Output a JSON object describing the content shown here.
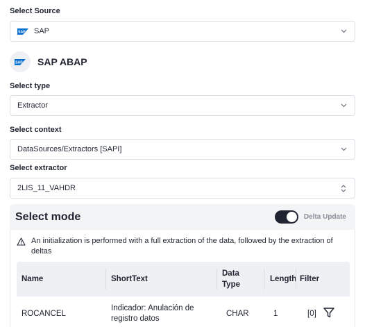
{
  "source": {
    "label": "Select Source",
    "value": "SAP",
    "title": "SAP ABAP",
    "logo_icon": "sap-logo-icon"
  },
  "type": {
    "label": "Select type",
    "value": "Extractor"
  },
  "context": {
    "label": "Select context",
    "value": "DataSources/Extractors [SAPI]"
  },
  "extractor": {
    "label": "Select extractor",
    "value": "2LIS_11_VAHDR"
  },
  "mode": {
    "title": "Select mode",
    "toggle_label": "Delta Update",
    "toggle_on": true,
    "info": "An initialization is performed with a full extraction of the data, followed by the extraction of deltas"
  },
  "table": {
    "columns": {
      "name": "Name",
      "short_text": "ShortText",
      "data_type": "Data Type",
      "length": "Length",
      "filter": "Filter"
    },
    "rows": [
      {
        "name": "ROCANCEL",
        "short_text": "Indicador: Anulación de registro datos",
        "data_type": "CHAR",
        "length": "1",
        "filter": "[0]"
      }
    ]
  },
  "colors": {
    "accent": "#1f2430",
    "border": "#dcdfe5",
    "panel": "#f3f4f6",
    "sap_blue": "#0a6ed1"
  }
}
